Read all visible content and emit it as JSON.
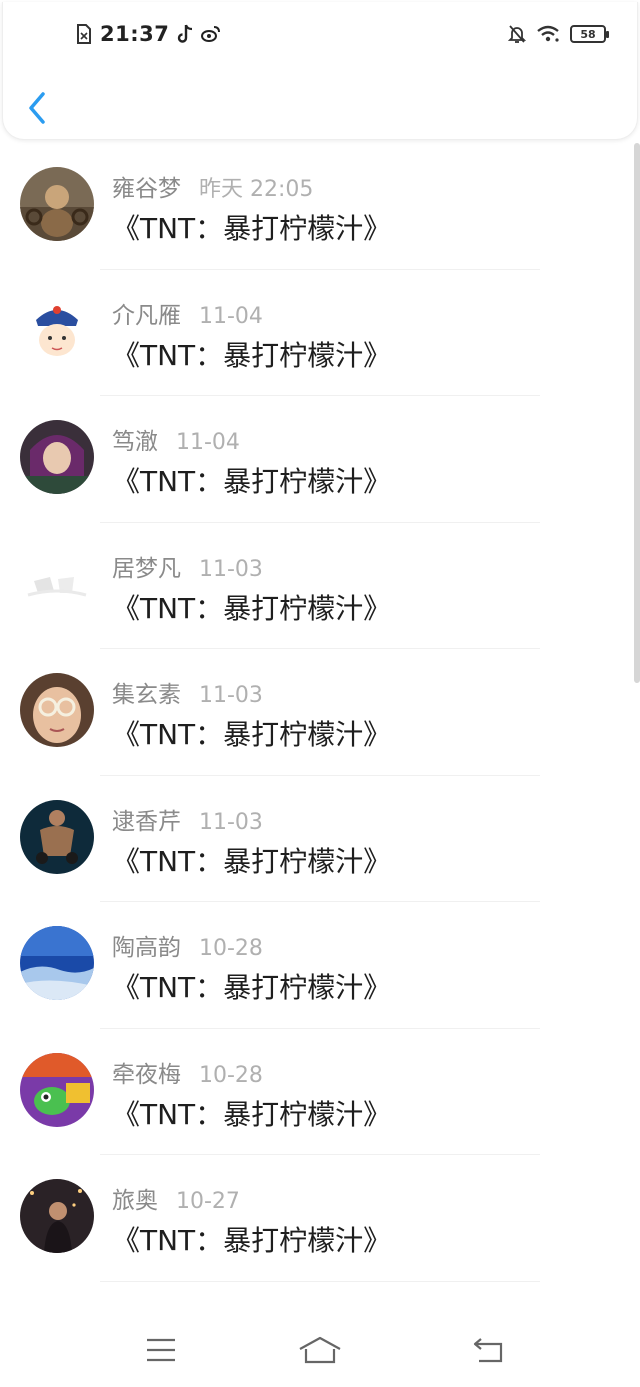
{
  "status_bar": {
    "time": "21:37",
    "left_icons": [
      "sim-card-icon",
      "tiktok-icon",
      "weibo-icon"
    ],
    "right_icons": [
      "bell-muted-icon",
      "wifi-icon",
      "battery-icon"
    ],
    "battery": "58"
  },
  "header": {
    "back_icon": "chevron-left-icon",
    "accent_color": "#2b9cf0"
  },
  "list": [
    {
      "name": "雍谷梦",
      "date": "昨天 22:05",
      "title": "《TNT：暴打柠檬汁》",
      "avatar": "avatar-1"
    },
    {
      "name": "介凡雁",
      "date": "11-04",
      "title": "《TNT：暴打柠檬汁》",
      "avatar": "avatar-2"
    },
    {
      "name": "笃澈",
      "date": "11-04",
      "title": "《TNT：暴打柠檬汁》",
      "avatar": "avatar-3"
    },
    {
      "name": "居梦凡",
      "date": "11-03",
      "title": "《TNT：暴打柠檬汁》",
      "avatar": "avatar-4"
    },
    {
      "name": "集玄素",
      "date": "11-03",
      "title": "《TNT：暴打柠檬汁》",
      "avatar": "avatar-5"
    },
    {
      "name": "逮香芹",
      "date": "11-03",
      "title": "《TNT：暴打柠檬汁》",
      "avatar": "avatar-6"
    },
    {
      "name": "陶高韵",
      "date": "10-28",
      "title": "《TNT：暴打柠檬汁》",
      "avatar": "avatar-7"
    },
    {
      "name": "牵夜梅",
      "date": "10-28",
      "title": "《TNT：暴打柠檬汁》",
      "avatar": "avatar-8"
    },
    {
      "name": "旅奥",
      "date": "10-27",
      "title": "《TNT：暴打柠檬汁》",
      "avatar": "avatar-9"
    }
  ],
  "nav_bar": {
    "icons": [
      "menu-icon",
      "home-icon",
      "back-icon"
    ]
  }
}
